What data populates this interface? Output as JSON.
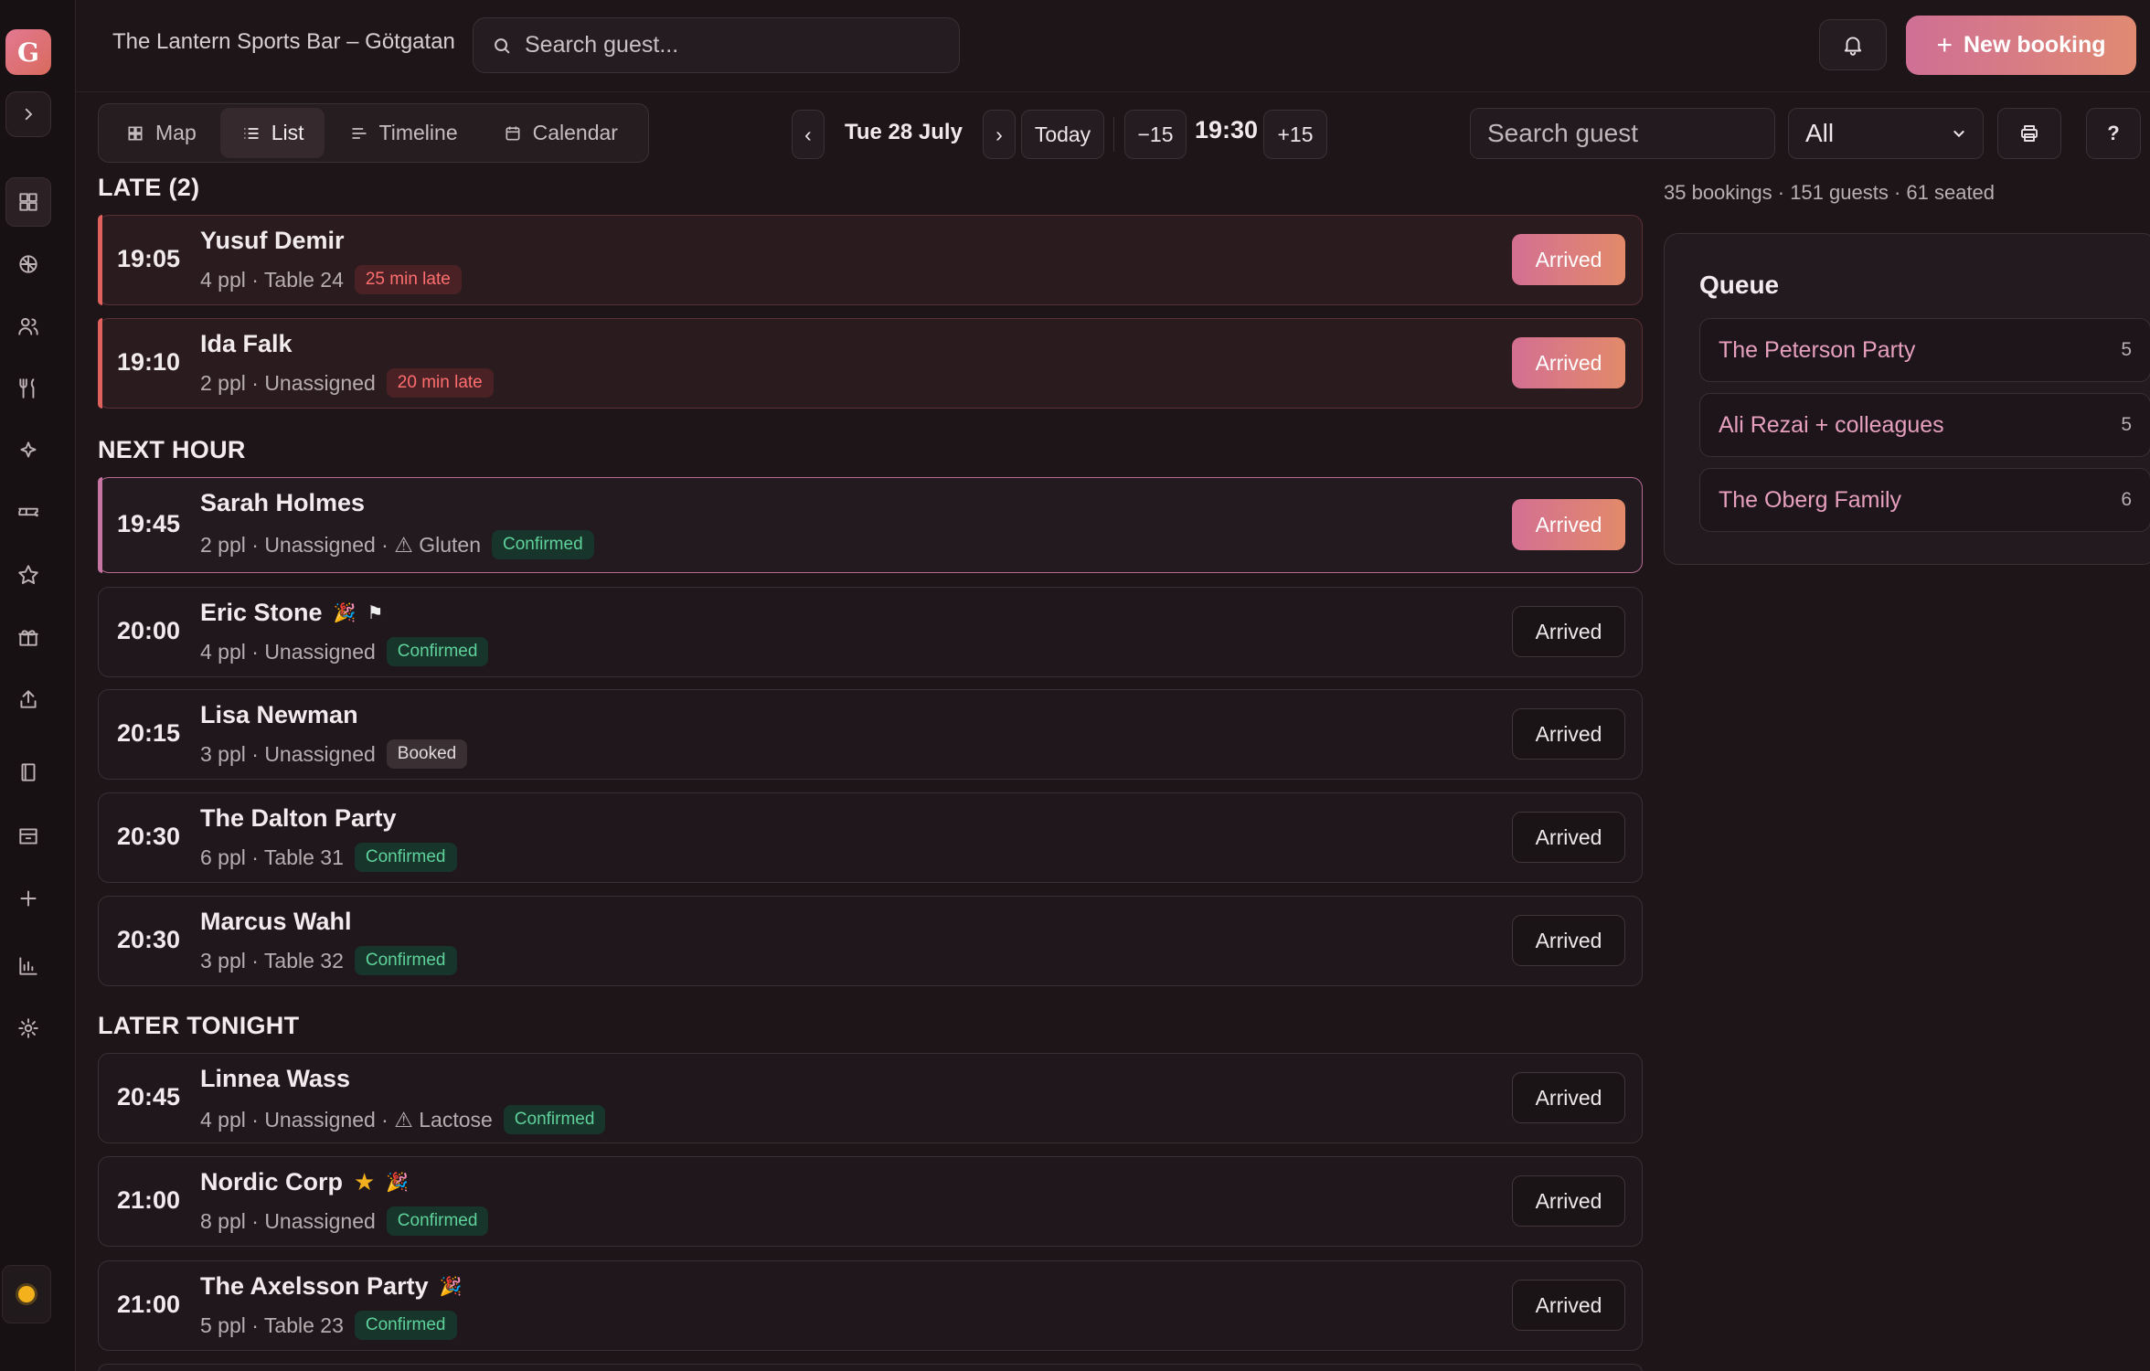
{
  "app": {
    "logo_letter": "G",
    "venue": "The Lantern Sports Bar – Götgatan"
  },
  "header": {
    "search_placeholder": "Search guest...",
    "new_booking_label": "New booking"
  },
  "sidebar": {
    "icons": [
      "dashboard-icon",
      "globe-icon",
      "users-icon",
      "cutlery-icon",
      "sparkle-icon",
      "ticket-icon",
      "star-icon",
      "gift-icon",
      "upload-icon",
      "book-icon",
      "inbox-icon",
      "plus-icon",
      "bar-chart-icon",
      "settings-icon"
    ]
  },
  "toolbar": {
    "tabs": [
      {
        "label": "Map",
        "icon": "grid-icon",
        "active": false
      },
      {
        "label": "List",
        "icon": "list-icon",
        "active": true
      },
      {
        "label": "Timeline",
        "icon": "timeline-icon",
        "active": false
      },
      {
        "label": "Calendar",
        "icon": "calendar-icon",
        "active": false
      }
    ],
    "prev_label": "‹",
    "next_label": "›",
    "date": "Tue 28 July",
    "today_label": "Today",
    "minus_label": "−15",
    "time": "19:30",
    "plus_label": "+15",
    "search_placeholder": "Search guest",
    "filter_value": "All",
    "help_label": "?"
  },
  "sections": {
    "late_title": "LATE (2)",
    "next_title": "NEXT HOUR",
    "later_title": "LATER TONIGHT"
  },
  "bookings": [
    {
      "time": "19:05",
      "name": "Yusuf Demir",
      "meta": "4 ppl · Table 24",
      "badge": "25 min late",
      "action": "Arrived"
    },
    {
      "time": "19:10",
      "name": "Ida Falk",
      "meta": "2 ppl · Unassigned",
      "badge": "20 min late",
      "action": "Arrived"
    },
    {
      "time": "19:45",
      "name": "Sarah Holmes",
      "meta": "2 ppl · Unassigned · ⚠ Gluten",
      "badge": "Confirmed",
      "action": "Arrived"
    },
    {
      "time": "20:00",
      "name": "Eric Stone",
      "meta": "4 ppl · Unassigned",
      "badge": "Confirmed",
      "action": "Arrived"
    },
    {
      "time": "20:15",
      "name": "Lisa Newman",
      "meta": "3 ppl · Unassigned",
      "badge": "Booked",
      "action": "Arrived"
    },
    {
      "time": "20:30",
      "name": "The Dalton Party",
      "meta": "6 ppl · Table 31",
      "badge": "Confirmed",
      "action": "Arrived"
    },
    {
      "time": "20:30",
      "name": "Marcus Wahl",
      "meta": "3 ppl · Table 32",
      "badge": "Confirmed",
      "action": "Arrived"
    },
    {
      "time": "20:45",
      "name": "Linnea Wass",
      "meta": "4 ppl · Unassigned · ⚠ Lactose",
      "badge": "Confirmed",
      "action": "Arrived"
    },
    {
      "time": "21:00",
      "name": "Nordic Corp",
      "meta": "8 ppl · Unassigned",
      "badge": "Confirmed",
      "action": "Arrived"
    },
    {
      "time": "21:00",
      "name": "The Axelsson Party",
      "meta": "5 ppl · Table 23",
      "badge": "Confirmed",
      "action": "Arrived"
    }
  ],
  "stats": {
    "text": "35 bookings · 151 guests · 61 seated"
  },
  "queue": {
    "title": "Queue",
    "items": [
      {
        "name": "The Peterson Party",
        "count": "5"
      },
      {
        "name": "Ali Rezai + colleagues",
        "count": "5"
      },
      {
        "name": "The Oberg Family",
        "count": "6"
      }
    ]
  },
  "colors": {
    "accent_gradient_start": "#cf6f95",
    "accent_gradient_end": "#e08a72",
    "late": "#ff6e6e",
    "confirmed": "#5fd29c"
  }
}
